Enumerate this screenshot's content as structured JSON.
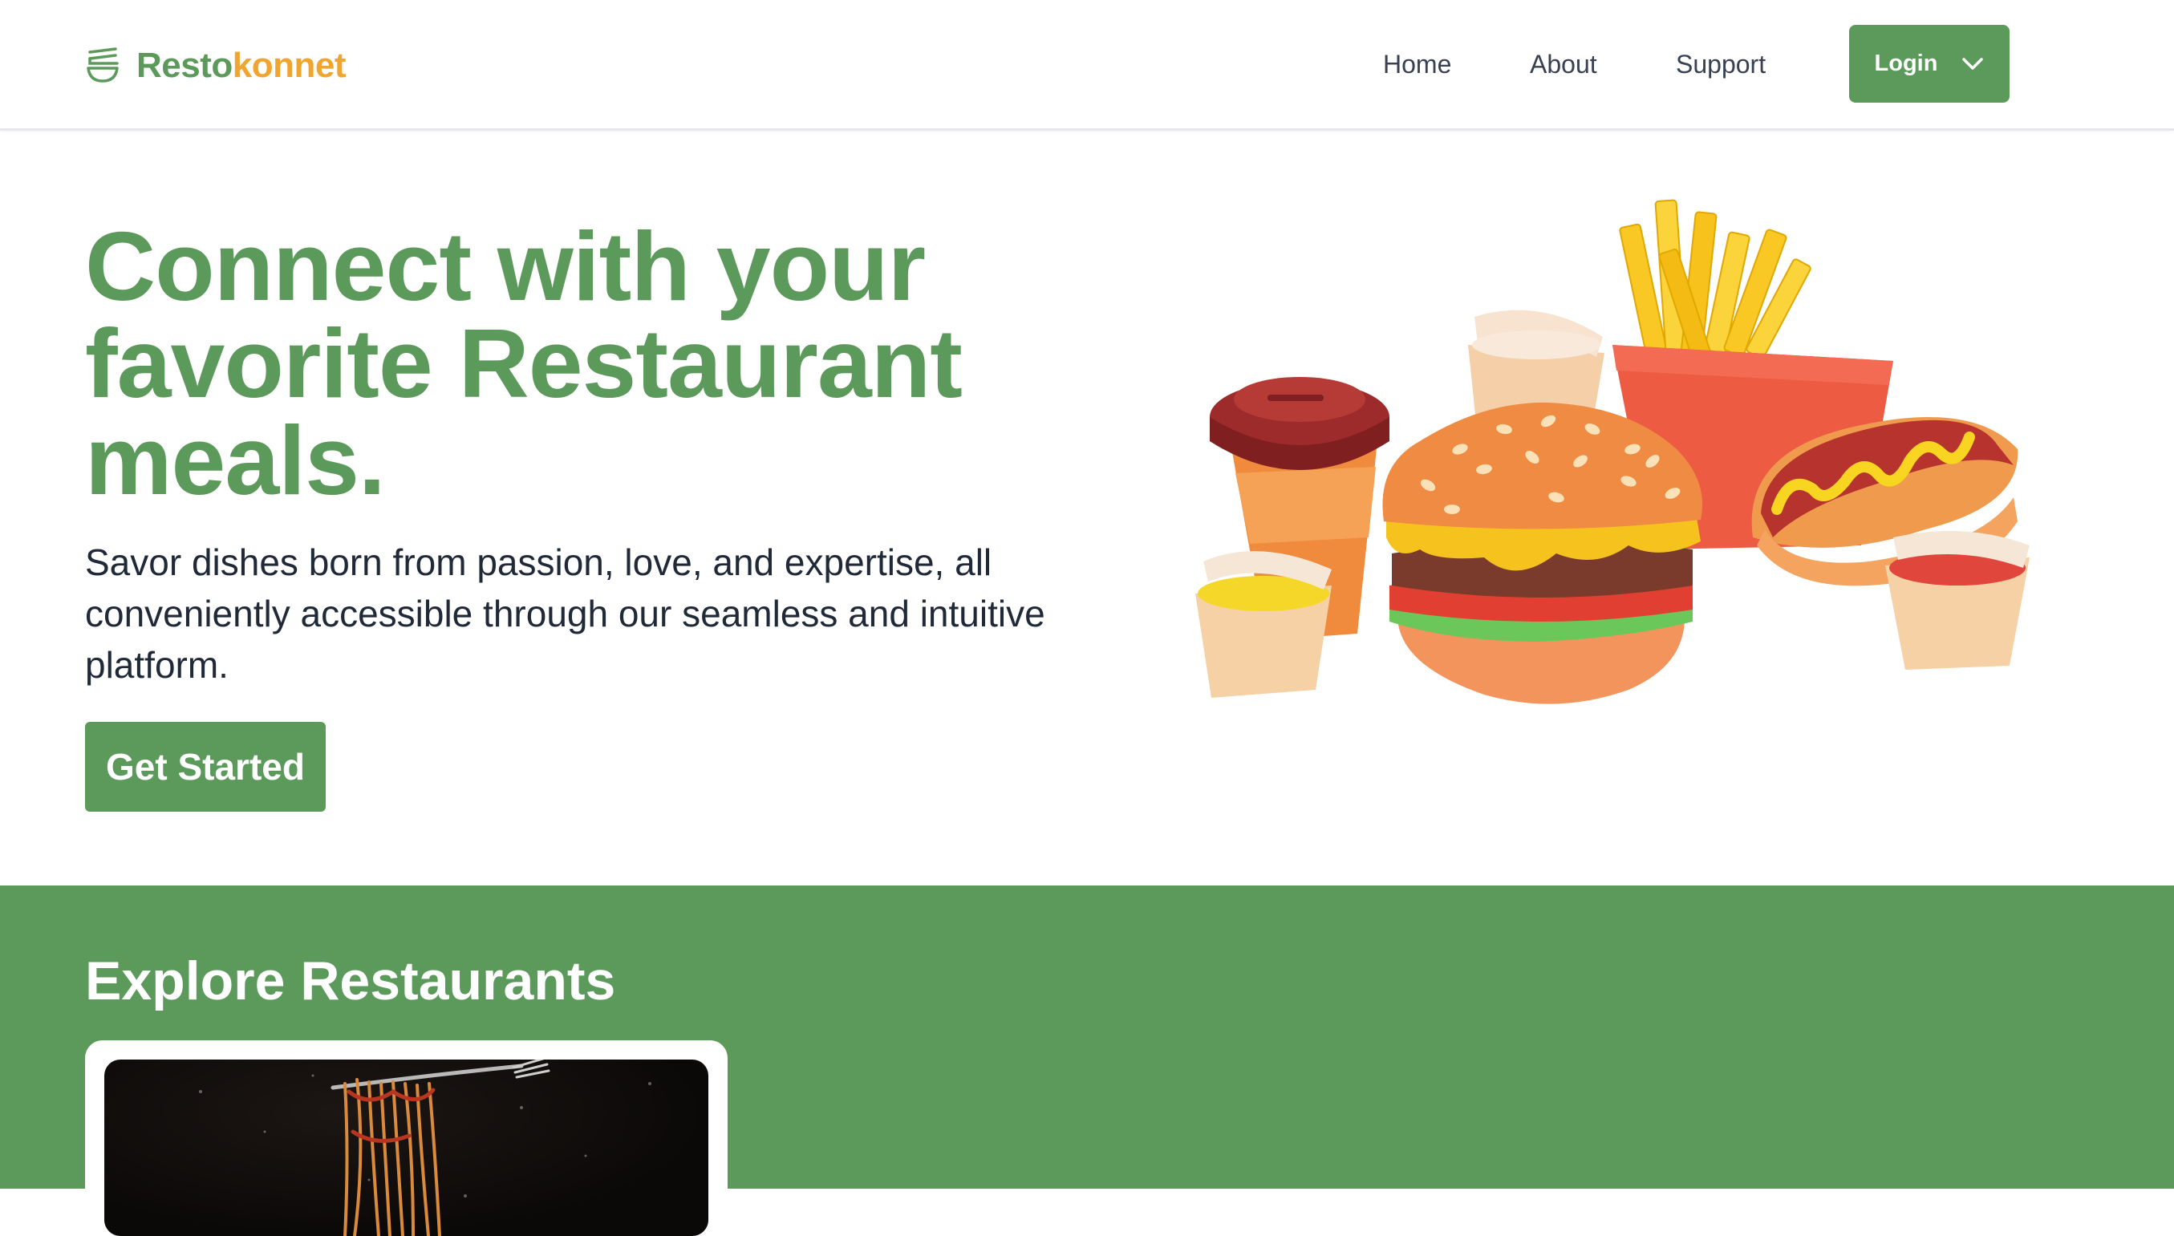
{
  "brand": {
    "part1": "Resto",
    "part2": "konnet",
    "icon": "bowl-icon"
  },
  "nav": {
    "home": "Home",
    "about": "About",
    "support": "Support",
    "login": "Login"
  },
  "hero": {
    "title": "Connect with your favorite Restaurant meals.",
    "subtitle": "Savor dishes born from passion, love, and expertise, all conveniently accessible through our seamless and intuitive platform.",
    "cta": "Get Started"
  },
  "explore": {
    "title": "Explore Restaurants"
  },
  "colors": {
    "brand_green": "#5c9a5b",
    "brand_orange": "#f0a52f",
    "text_dark": "#1f2937"
  }
}
